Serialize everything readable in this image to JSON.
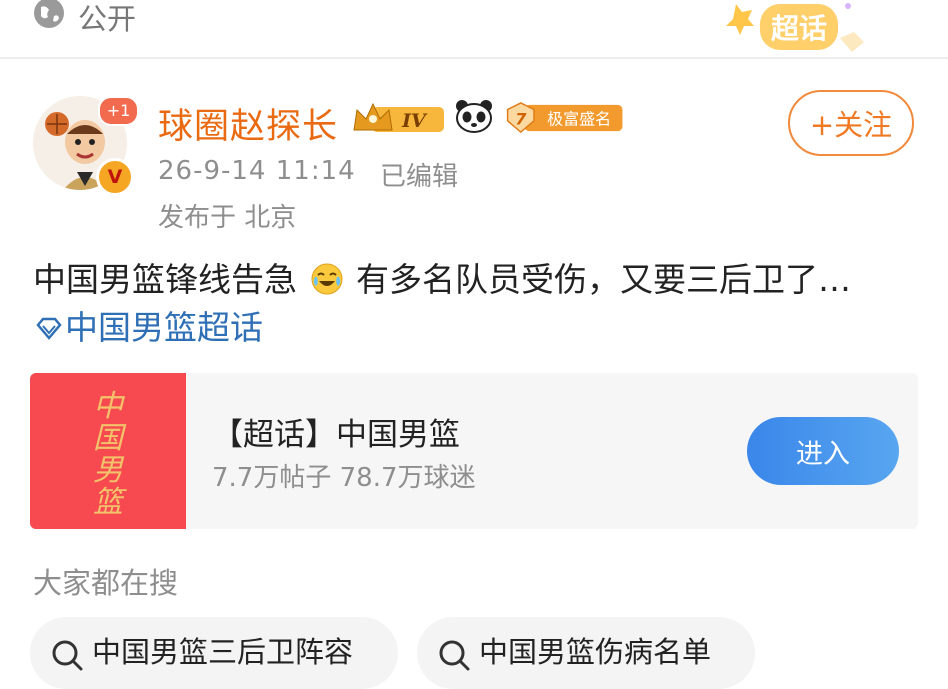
{
  "top": {
    "visibility_label": "公开",
    "chaohua_badge": "超话",
    "icons": {
      "visibility": "globe-icon",
      "chaohua": "chaohua-badge-icon"
    }
  },
  "author": {
    "name": "球圈赵探长",
    "avatar_notification": "+1",
    "verified_mark": "V",
    "level_badge": "IV",
    "fame_level": "7",
    "fame_label": "极富盛名",
    "follow_label": "+关注",
    "icons": {
      "crown": "crown-badge-icon",
      "panda": "panda-icon",
      "fame": "fame-badge-icon"
    }
  },
  "meta": {
    "time": "26-9-14 11:14",
    "edited": "已编辑",
    "location": "发布于 北京"
  },
  "post": {
    "text_part1": "中国男篮锋线告急",
    "emoji": "crying-laughing-emoji",
    "text_part2": " 有多名队员受伤，又要三后卫了… ",
    "topic": "中国男篮超话"
  },
  "supertopic_card": {
    "thumb_text": "中国男篮",
    "title": "【超话】中国男篮",
    "stats": "7.7万帖子 78.7万球迷",
    "enter_label": "进入"
  },
  "hot_search": {
    "heading": "大家都在搜",
    "items": [
      {
        "label": "中国男篮三后卫阵容"
      },
      {
        "label": "中国男篮伤病名单"
      }
    ]
  },
  "colors": {
    "username": "#ea6a12",
    "follow": "#f07a24",
    "link": "#2f6fb5",
    "enter_button": "#3a86ea",
    "thumb_bg": "#f64a50"
  }
}
